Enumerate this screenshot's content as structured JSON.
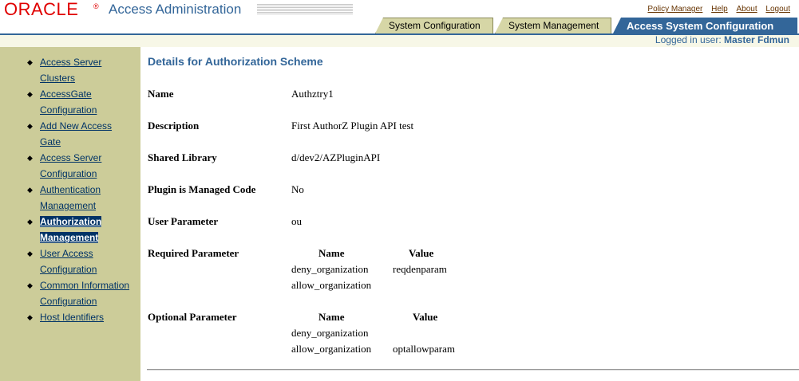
{
  "brand": {
    "logo_text": "ORACLE",
    "logo_mark": "®",
    "app_title": "Access Administration"
  },
  "global_links": [
    {
      "label": "Policy Manager"
    },
    {
      "label": "Help"
    },
    {
      "label": "About"
    },
    {
      "label": "Logout"
    }
  ],
  "tabs": [
    {
      "label": "System Configuration",
      "active": false
    },
    {
      "label": "System Management",
      "active": false
    },
    {
      "label": "Access System Configuration",
      "active": true
    }
  ],
  "logged_in": {
    "prefix": "Logged in user: ",
    "user": "Master Fdmun"
  },
  "sidebar": {
    "items": [
      {
        "line1": "Access Server",
        "line2": "Clusters",
        "selected": false
      },
      {
        "line1": "AccessGate",
        "line2": "Configuration",
        "selected": false
      },
      {
        "line1": "Add New Access",
        "line2": "Gate",
        "selected": false
      },
      {
        "line1": "Access Server",
        "line2": "Configuration",
        "selected": false
      },
      {
        "line1": "Authentication",
        "line2": "Management",
        "selected": false
      },
      {
        "line1": "Authorization",
        "line2": "Management",
        "selected": true
      },
      {
        "line1": "User Access",
        "line2": "Configuration",
        "selected": false
      },
      {
        "line1": "Common Information",
        "line2": "Configuration",
        "selected": false
      },
      {
        "line1": "Host Identifiers",
        "line2": "",
        "selected": false
      }
    ]
  },
  "main": {
    "title": "Details for Authorization Scheme",
    "fields": {
      "name": {
        "label": "Name",
        "value": "Authztry1"
      },
      "description": {
        "label": "Description",
        "value": "First AuthorZ Plugin API test"
      },
      "shared_library": {
        "label": "Shared Library",
        "value": "d/dev2/AZPluginAPI"
      },
      "managed_code": {
        "label": "Plugin is Managed Code",
        "value": "No"
      },
      "user_parameter": {
        "label": "User Parameter",
        "value": "ou"
      }
    },
    "required_parameter": {
      "label": "Required Parameter",
      "col_name": "Name",
      "col_value": "Value",
      "rows": [
        {
          "name": "deny_organization",
          "value": "reqdenparam"
        },
        {
          "name": "allow_organization",
          "value": ""
        }
      ]
    },
    "optional_parameter": {
      "label": "Optional Parameter",
      "col_name": "Name",
      "col_value": "Value",
      "rows": [
        {
          "name": "deny_organization",
          "value": ""
        },
        {
          "name": "allow_organization",
          "value": "optallowparam"
        }
      ]
    }
  },
  "colors": {
    "brand_red": "#e00000",
    "accent_blue": "#336699",
    "sidebar_bg": "#cccc99",
    "tab_bg": "#d6d6a6",
    "subbar_bg": "#f7f7e7"
  }
}
